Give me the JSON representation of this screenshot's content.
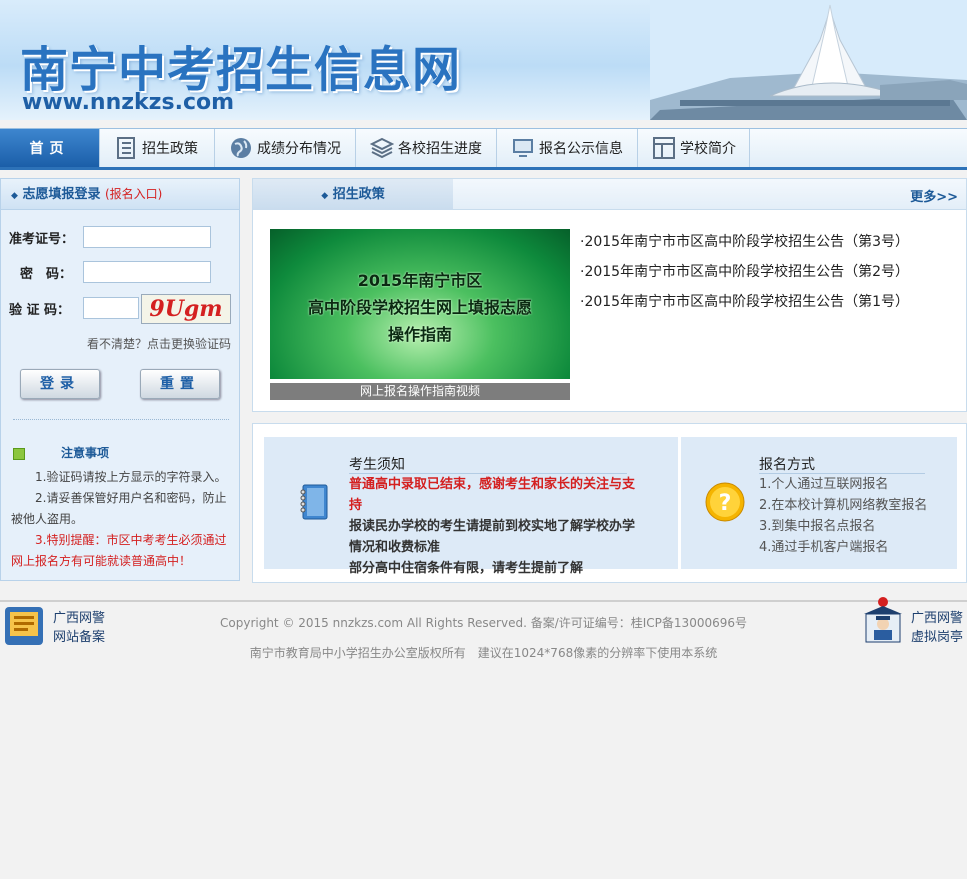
{
  "banner": {
    "title": "南宁中考招生信息网",
    "url": "www.nnzkzs.com"
  },
  "nav": {
    "items": [
      {
        "label": "首页",
        "icon": "home"
      },
      {
        "label": "招生政策",
        "icon": "list-icon"
      },
      {
        "label": "成绩分布情况",
        "icon": "globe-icon"
      },
      {
        "label": "各校招生进度",
        "icon": "layers-icon"
      },
      {
        "label": "报名公示信息",
        "icon": "monitor-icon"
      },
      {
        "label": "学校简介",
        "icon": "window-icon"
      }
    ]
  },
  "login": {
    "title": "志愿填报登录",
    "subtitle": "(报名入口)",
    "id_label": "准考证号：",
    "password_label": "密　码：",
    "captcha_label": "验 证 码：",
    "captcha_text": "9Ugm",
    "refresh_hint": "看不清楚？点击更换验证码",
    "login_button": "登录",
    "reset_button": "重置"
  },
  "notice": {
    "title": "注意事项",
    "items": [
      "1.验证码请按上方显示的字符录入。",
      "2.请妥善保管好用户名和密码，防止被他人盗用。",
      "3.特别提醒：市区中考考生必须通过网上报名方有可能就读普通高中！"
    ]
  },
  "policy": {
    "tab_label": "招生政策",
    "more_label": "更多>>",
    "video_title_line1": "2015年南宁市区",
    "video_title_line2": "高中阶段学校招生网上填报志愿",
    "video_title_line3": "操作指南",
    "video_caption": "网上报名操作指南视频",
    "news": [
      "·2015年南宁市市区高中阶段学校招生公告（第3号）",
      "·2015年南宁市市区高中阶段学校招生公告（第2号）",
      "·2015年南宁市市区高中阶段学校招生公告（第1号）"
    ]
  },
  "info": {
    "notice_title": "考生须知",
    "notice_items": [
      "普通高中录取已结束，感谢考生和家长的关注与支持",
      "报读民办学校的考生请提前到校实地了解学校办学情况和收费标准",
      "部分高中住宿条件有限，请考生提前了解"
    ],
    "signup_title": "报名方式",
    "signup_items": [
      "1.个人通过互联网报名",
      "2.在本校计算机网络教室报名",
      "3.到集中报名点报名",
      "4.通过手机客户端报名"
    ]
  },
  "footer": {
    "left_line1": "广西网警",
    "left_line2": "网站备案",
    "copyright": "Copyright © 2015   nnzkzs.com   All Rights Reserved. 备案/许可证编号：桂ICP备13000696号",
    "owner": "南宁市教育局中小学招生办公室版权所有　建议在1024*768像素的分辨率下使用本系统",
    "right_line1": "广西网警",
    "right_line2": "虚拟岗亭"
  },
  "colors": {
    "brand_blue": "#1d5a98",
    "nav_active": "#2d72b8",
    "warning_red": "#d42020"
  }
}
